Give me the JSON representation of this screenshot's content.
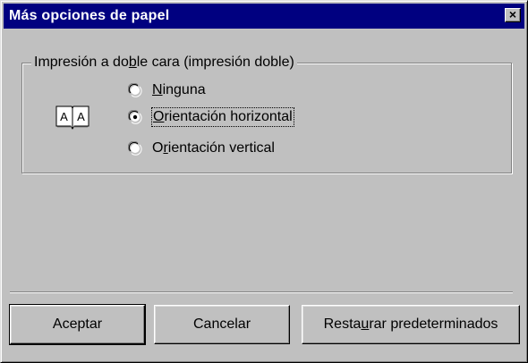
{
  "window": {
    "title": "Más opciones de papel",
    "close_label": "×"
  },
  "duplex_group": {
    "legend_pre": "Impresión a do",
    "legend_key": "b",
    "legend_post": "le cara (impresión doble)",
    "options": [
      {
        "key": "N",
        "rest": "inguna",
        "selected": false
      },
      {
        "key": "O",
        "rest": "rientación horizontal",
        "selected": true
      },
      {
        "pre": "O",
        "key": "r",
        "rest": "ientación vertical",
        "selected": false
      }
    ],
    "icon": "duplex-book-icon"
  },
  "buttons": {
    "ok": "Aceptar",
    "cancel": "Cancelar",
    "restore_pre": "Resta",
    "restore_key": "u",
    "restore_post": "rar predeterminados"
  }
}
